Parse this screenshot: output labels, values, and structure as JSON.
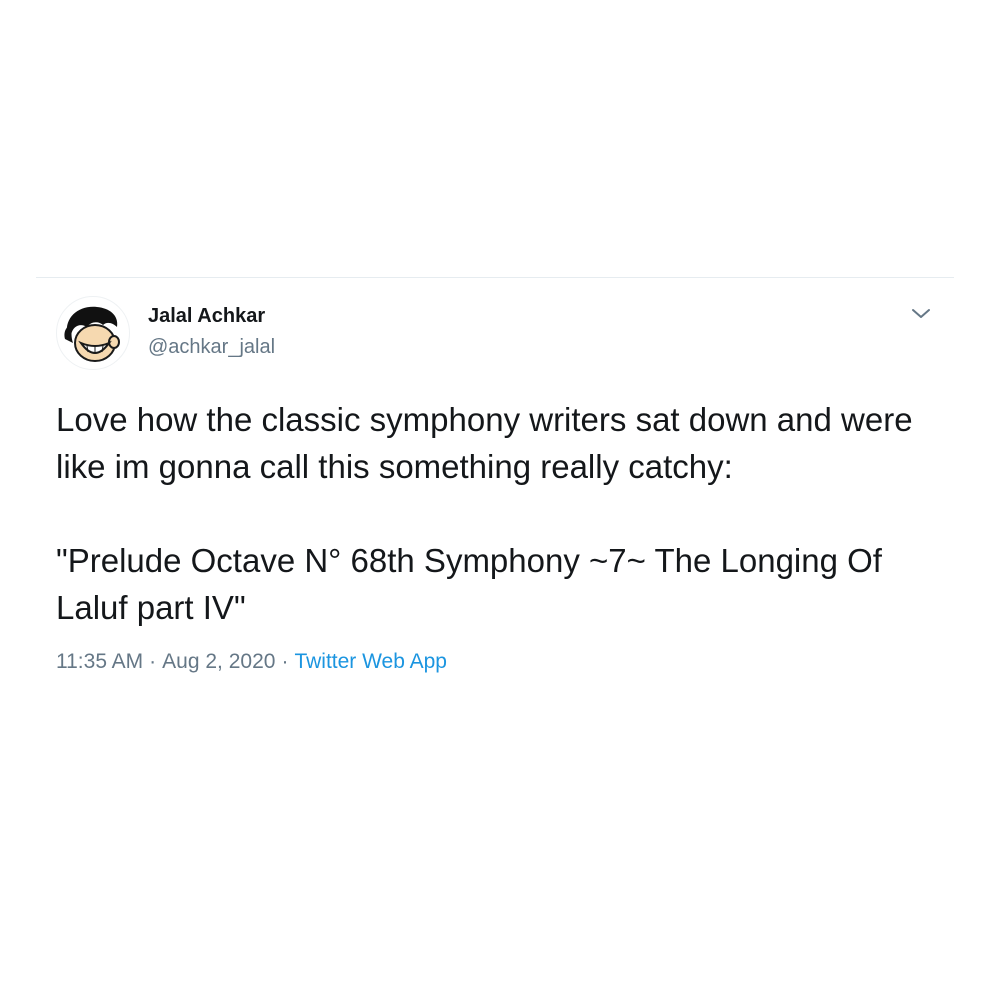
{
  "tweet": {
    "author": {
      "display_name": "Jalal Achkar",
      "handle": "@achkar_jalal",
      "avatar_icon": "cartoon-face-avatar"
    },
    "text": "Love how the classic symphony writers sat down and were like im gonna call this something really catchy:\n\n\"Prelude Octave N° 68th Symphony ~7~ The Longing Of Laluf part IV\"",
    "time": "11:35 AM",
    "separator": "·",
    "date": "Aug 2, 2020",
    "source": "Twitter Web App",
    "menu_icon": "chevron-down-icon"
  },
  "colors": {
    "text": "#14171a",
    "secondary": "#657786",
    "link": "#1b95e0",
    "divider": "#e6ecf0"
  }
}
